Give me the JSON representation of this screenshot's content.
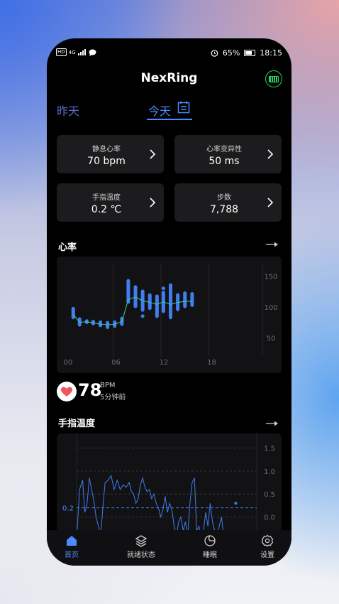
{
  "status": {
    "left_chip": "HD",
    "signal": "4G",
    "battery_pct": "65%",
    "time": "18:15"
  },
  "app": {
    "title": "NexRing"
  },
  "tabs": {
    "yesterday": "昨天",
    "today": "今天"
  },
  "cards": [
    {
      "label": "静息心率",
      "value": "70 bpm"
    },
    {
      "label": "心率变异性",
      "value": "50 ms"
    },
    {
      "label": "手指温度",
      "value": "0.2 ℃"
    },
    {
      "label": "步数",
      "value": "7,788"
    }
  ],
  "heart_rate_section": {
    "title": "心率"
  },
  "temperature_section": {
    "title": "手指温度"
  },
  "hr_summary": {
    "value": "78",
    "unit": "BPM",
    "time_ago": "5分钟前"
  },
  "colors": {
    "accent": "#4a8bff",
    "ring_ok": "#27d05f",
    "heart": "#f0545e"
  },
  "chart_data": [
    {
      "type": "bar",
      "x_tick_labels": [
        "00",
        "06",
        "12",
        "18"
      ],
      "y_tick_labels": [
        "150",
        "100",
        "50"
      ],
      "ylim": [
        25,
        170
      ],
      "xlim": [
        0,
        24
      ],
      "ranges": [
        {
          "x": 1.0,
          "low": 80,
          "high": 100
        },
        {
          "x": 1.8,
          "low": 68,
          "high": 83
        },
        {
          "x": 2.7,
          "low": 72,
          "high": 80
        },
        {
          "x": 3.5,
          "low": 70,
          "high": 79
        },
        {
          "x": 4.4,
          "low": 67,
          "high": 78
        },
        {
          "x": 5.3,
          "low": 64,
          "high": 77
        },
        {
          "x": 6.2,
          "low": 66,
          "high": 78
        },
        {
          "x": 7.1,
          "low": 69,
          "high": 84
        },
        {
          "x": 7.9,
          "low": 105,
          "high": 145
        },
        {
          "x": 8.8,
          "low": 98,
          "high": 135
        },
        {
          "x": 9.7,
          "low": 92,
          "high": 128
        },
        {
          "x": 10.6,
          "low": 95,
          "high": 122
        },
        {
          "x": 11.5,
          "low": 82,
          "high": 120
        },
        {
          "x": 12.3,
          "low": 90,
          "high": 126
        },
        {
          "x": 13.2,
          "low": 80,
          "high": 138
        },
        {
          "x": 14.1,
          "low": 93,
          "high": 122
        },
        {
          "x": 15.0,
          "low": 98,
          "high": 125
        },
        {
          "x": 15.9,
          "low": 100,
          "high": 124
        }
      ],
      "dots": [
        {
          "x": 9.7,
          "y": 85
        },
        {
          "x": 12.3,
          "y": 130
        }
      ],
      "trend": [
        {
          "x": 1.0,
          "y": 88
        },
        {
          "x": 1.8,
          "y": 75
        },
        {
          "x": 2.7,
          "y": 76
        },
        {
          "x": 3.5,
          "y": 74
        },
        {
          "x": 4.4,
          "y": 72
        },
        {
          "x": 5.3,
          "y": 71
        },
        {
          "x": 6.2,
          "y": 72
        },
        {
          "x": 7.1,
          "y": 76
        },
        {
          "x": 7.9,
          "y": 112
        },
        {
          "x": 8.8,
          "y": 116
        },
        {
          "x": 9.7,
          "y": 110
        },
        {
          "x": 10.6,
          "y": 107
        },
        {
          "x": 11.5,
          "y": 104
        },
        {
          "x": 12.3,
          "y": 108
        },
        {
          "x": 13.2,
          "y": 104
        },
        {
          "x": 14.1,
          "y": 107
        },
        {
          "x": 15.0,
          "y": 109
        },
        {
          "x": 15.9,
          "y": 109
        }
      ]
    },
    {
      "type": "line",
      "y_tick_labels": [
        "1.5",
        "1.0",
        "0.5",
        "0.0"
      ],
      "reference_label": "0.2",
      "reference_value": 0.2,
      "ylim": [
        -0.5,
        1.6
      ],
      "xlim": [
        0,
        24
      ],
      "points": [
        [
          0.0,
          -0.5
        ],
        [
          0.4,
          0.6
        ],
        [
          0.8,
          0.8
        ],
        [
          1.1,
          0.1
        ],
        [
          1.4,
          0.3
        ],
        [
          1.7,
          0.85
        ],
        [
          2.0,
          0.6
        ],
        [
          2.3,
          0.35
        ],
        [
          2.6,
          0.0
        ],
        [
          2.9,
          -0.2
        ],
        [
          3.2,
          -0.4
        ],
        [
          3.5,
          0.2
        ],
        [
          3.8,
          0.75
        ],
        [
          4.2,
          0.8
        ],
        [
          4.6,
          0.9
        ],
        [
          5.0,
          0.6
        ],
        [
          5.4,
          0.8
        ],
        [
          5.8,
          0.6
        ],
        [
          6.2,
          0.7
        ],
        [
          6.6,
          0.65
        ],
        [
          7.0,
          0.75
        ],
        [
          7.3,
          0.55
        ],
        [
          7.6,
          0.5
        ],
        [
          7.9,
          0.3
        ],
        [
          8.2,
          0.4
        ],
        [
          8.5,
          0.7
        ],
        [
          8.8,
          0.85
        ],
        [
          9.1,
          0.65
        ],
        [
          9.4,
          0.55
        ],
        [
          9.7,
          0.6
        ],
        [
          10.0,
          0.4
        ],
        [
          10.3,
          0.5
        ],
        [
          10.6,
          0.3
        ],
        [
          10.9,
          0.2
        ],
        [
          11.2,
          0.0
        ],
        [
          11.5,
          0.15
        ],
        [
          11.8,
          0.45
        ],
        [
          12.1,
          0.1
        ],
        [
          12.4,
          0.3
        ],
        [
          12.7,
          0.15
        ],
        [
          13.0,
          -0.2
        ],
        [
          13.3,
          -0.4
        ],
        [
          13.6,
          -0.1
        ],
        [
          13.9,
          0.0
        ],
        [
          14.2,
          -0.3
        ],
        [
          14.5,
          -0.1
        ],
        [
          14.8,
          -0.45
        ],
        [
          15.1,
          0.3
        ],
        [
          15.4,
          0.75
        ],
        [
          15.7,
          0.85
        ],
        [
          16.0,
          -0.3
        ],
        [
          16.3,
          -0.2
        ],
        [
          16.6,
          -0.45
        ],
        [
          16.9,
          -0.3
        ],
        [
          17.2,
          0.1
        ],
        [
          17.5,
          -0.2
        ],
        [
          17.8,
          0.3
        ],
        [
          18.1,
          -0.1
        ],
        [
          18.4,
          -0.3
        ],
        [
          18.7,
          -0.5
        ],
        [
          19.0,
          -0.2
        ],
        [
          19.3,
          0.0
        ],
        [
          19.6,
          -0.4
        ],
        [
          19.9,
          -0.35
        ],
        [
          20.2,
          -0.5
        ]
      ],
      "last_point": {
        "x": 21.2,
        "y": 0.3
      }
    }
  ]
}
